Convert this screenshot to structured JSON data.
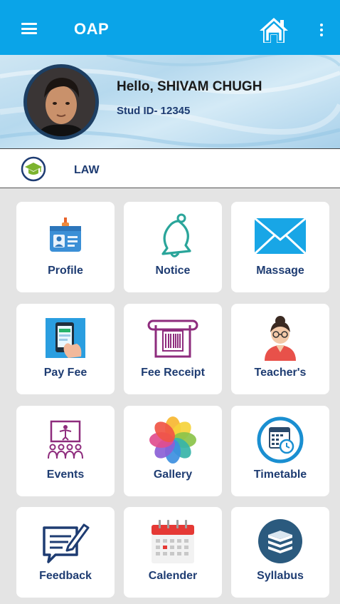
{
  "appbar": {
    "title": "OAP",
    "menu_icon": "hamburger-menu-icon",
    "home_icon": "home-icon",
    "more_icon": "more-vertical-icon",
    "color": "#0aa4e8"
  },
  "profile": {
    "greeting": "Hello, SHIVAM CHUGH",
    "stud_id": "Stud ID- 12345"
  },
  "course": {
    "label": "LAW",
    "icon": "graduation-cap-icon"
  },
  "tiles": [
    {
      "label": "Profile",
      "icon": "id-card-icon"
    },
    {
      "label": "Notice",
      "icon": "bell-icon"
    },
    {
      "label": "Massage",
      "icon": "envelope-icon"
    },
    {
      "label": "Pay Fee",
      "icon": "phone-payment-icon"
    },
    {
      "label": "Fee Receipt",
      "icon": "receipt-printer-icon"
    },
    {
      "label": "Teacher's",
      "icon": "teacher-icon"
    },
    {
      "label": "Events",
      "icon": "presentation-icon"
    },
    {
      "label": "Gallery",
      "icon": "photos-flower-icon"
    },
    {
      "label": "Timetable",
      "icon": "timetable-clock-icon"
    },
    {
      "label": "Feedback",
      "icon": "feedback-form-icon"
    },
    {
      "label": "Calender",
      "icon": "calendar-icon"
    },
    {
      "label": "Syllabus",
      "icon": "books-stack-icon"
    }
  ],
  "colors": {
    "label_text": "#1e3c72",
    "grid_background": "#e4e4e4"
  }
}
